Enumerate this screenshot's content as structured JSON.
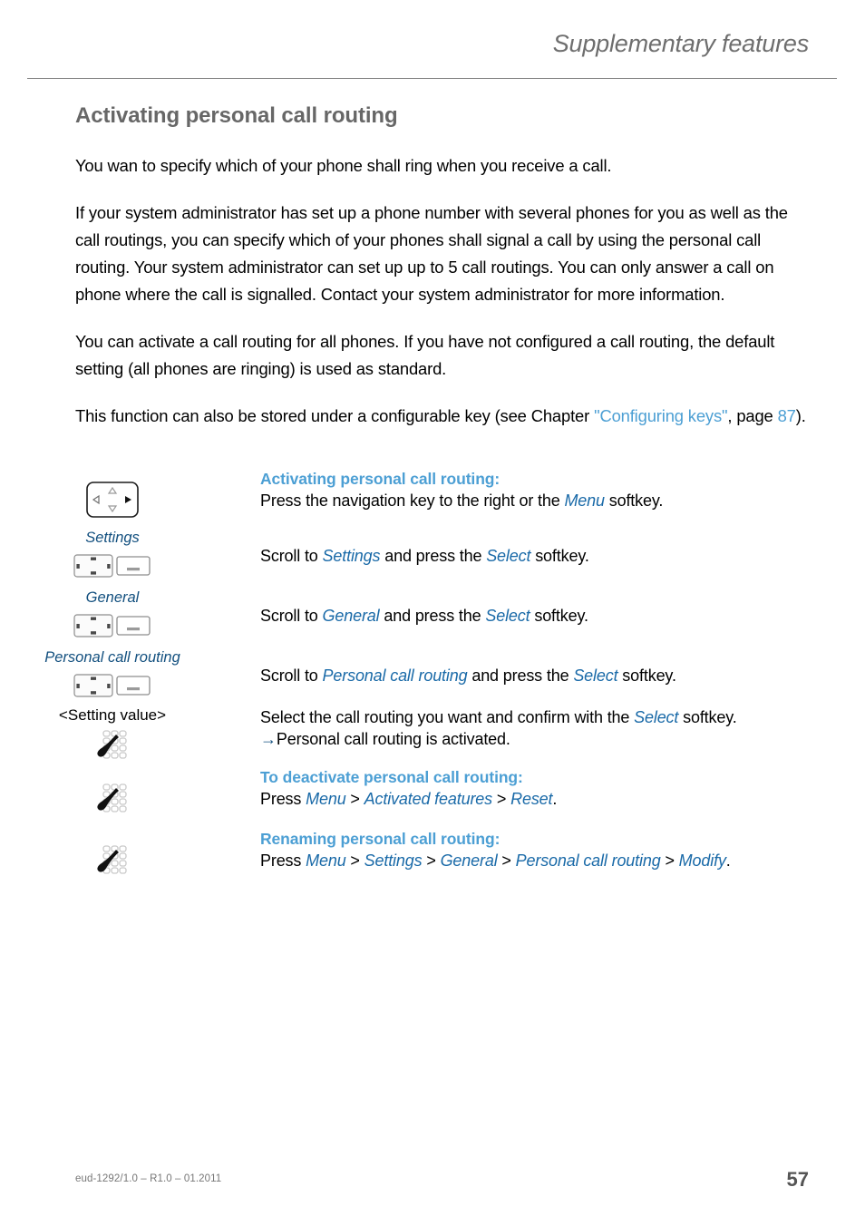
{
  "header": {
    "title": "Supplementary features"
  },
  "section": {
    "title": "Activating personal call routing"
  },
  "paragraphs": {
    "p1": "You wan to specify which of your phone shall ring when you receive a call.",
    "p2": "If your system administrator has set up a phone number with several phones for you as well as the call routings, you can specify which of your phones shall signal a call by using the personal call routing. Your system administrator can set up up to 5 call routings. You can only answer a call on phone where the call is signalled. Contact your system administrator for more information.",
    "p3": "You can activate a call routing for all phones. If you have not configured a call routing, the default setting (all phones are ringing) is used as standard.",
    "p4_before": "This function can also be stored under a configurable key (see Chapter ",
    "p4_link": "\"Configuring keys\"",
    "p4_mid": ", page ",
    "p4_page": "87",
    "p4_after": ")."
  },
  "steps": [
    {
      "icon": "navigation-key-large-icon",
      "label": "",
      "heading": "Activating personal call routing:",
      "text_parts": [
        {
          "t": "Press the navigation key to the right or the ",
          "style": "plain"
        },
        {
          "t": "Menu",
          "style": "menu"
        },
        {
          "t": " softkey.",
          "style": "plain"
        }
      ]
    },
    {
      "icon": "navigation-key-softkey-icon",
      "label": "Settings",
      "label_style": "menu",
      "heading": "",
      "text_parts": [
        {
          "t": "Scroll to ",
          "style": "plain"
        },
        {
          "t": "Settings",
          "style": "menu"
        },
        {
          "t": " and press the ",
          "style": "plain"
        },
        {
          "t": "Select",
          "style": "menu"
        },
        {
          "t": " softkey.",
          "style": "plain"
        }
      ]
    },
    {
      "icon": "navigation-key-softkey-icon",
      "label": "General",
      "label_style": "menu",
      "heading": "",
      "text_parts": [
        {
          "t": "Scroll to ",
          "style": "plain"
        },
        {
          "t": "General",
          "style": "menu"
        },
        {
          "t": " and press the ",
          "style": "plain"
        },
        {
          "t": "Select",
          "style": "menu"
        },
        {
          "t": " softkey.",
          "style": "plain"
        }
      ]
    },
    {
      "icon": "navigation-key-softkey-icon",
      "label": "Personal call routing",
      "label_style": "menu",
      "heading": "",
      "text_parts": [
        {
          "t": "Scroll to ",
          "style": "plain"
        },
        {
          "t": "Personal call routing",
          "style": "menu"
        },
        {
          "t": " and press the ",
          "style": "plain"
        },
        {
          "t": "Select",
          "style": "menu"
        },
        {
          "t": " softkey.",
          "style": "plain"
        }
      ]
    },
    {
      "icon": "keypad-handset-icon",
      "label": "<Setting value>",
      "label_style": "plain",
      "heading": "",
      "text_parts": [
        {
          "t": "Select the call routing you want and confirm with the ",
          "style": "plain"
        },
        {
          "t": "Select",
          "style": "menu"
        },
        {
          "t": " softkey.",
          "style": "plain"
        }
      ],
      "result": "Personal call routing is activated.",
      "result_arrow": "→"
    },
    {
      "icon": "keypad-handset-icon",
      "label": "",
      "heading": "To deactivate personal call routing:",
      "text_parts": [
        {
          "t": "Press ",
          "style": "plain"
        },
        {
          "t": "Menu",
          "style": "menu"
        },
        {
          "t": " > ",
          "style": "plain"
        },
        {
          "t": "Activated features",
          "style": "menu"
        },
        {
          "t": " > ",
          "style": "plain"
        },
        {
          "t": "Reset",
          "style": "menu"
        },
        {
          "t": ".",
          "style": "plain"
        }
      ]
    },
    {
      "icon": "keypad-handset-icon",
      "label": "",
      "heading": "Renaming personal call routing:",
      "text_parts": [
        {
          "t": "Press ",
          "style": "plain"
        },
        {
          "t": "Menu",
          "style": "menu"
        },
        {
          "t": " > ",
          "style": "plain"
        },
        {
          "t": "Settings",
          "style": "menu"
        },
        {
          "t": " > ",
          "style": "plain"
        },
        {
          "t": "General",
          "style": "menu"
        },
        {
          "t": " > ",
          "style": "plain"
        },
        {
          "t": "Personal call routing",
          "style": "menu"
        },
        {
          "t": " > ",
          "style": "plain"
        },
        {
          "t": "Modify",
          "style": "menu"
        },
        {
          "t": ".",
          "style": "plain"
        }
      ]
    }
  ],
  "footer": {
    "reference": "eud-1292/1.0 – R1.0 – 01.2011",
    "page_number": "57"
  },
  "colors": {
    "header_gray": "#6e6e6e",
    "title_gray": "#676767",
    "link_blue": "#4c9fd4",
    "menu_blue": "#1a6aa8",
    "label_blue": "#13507f",
    "rule_gray": "#808080"
  }
}
